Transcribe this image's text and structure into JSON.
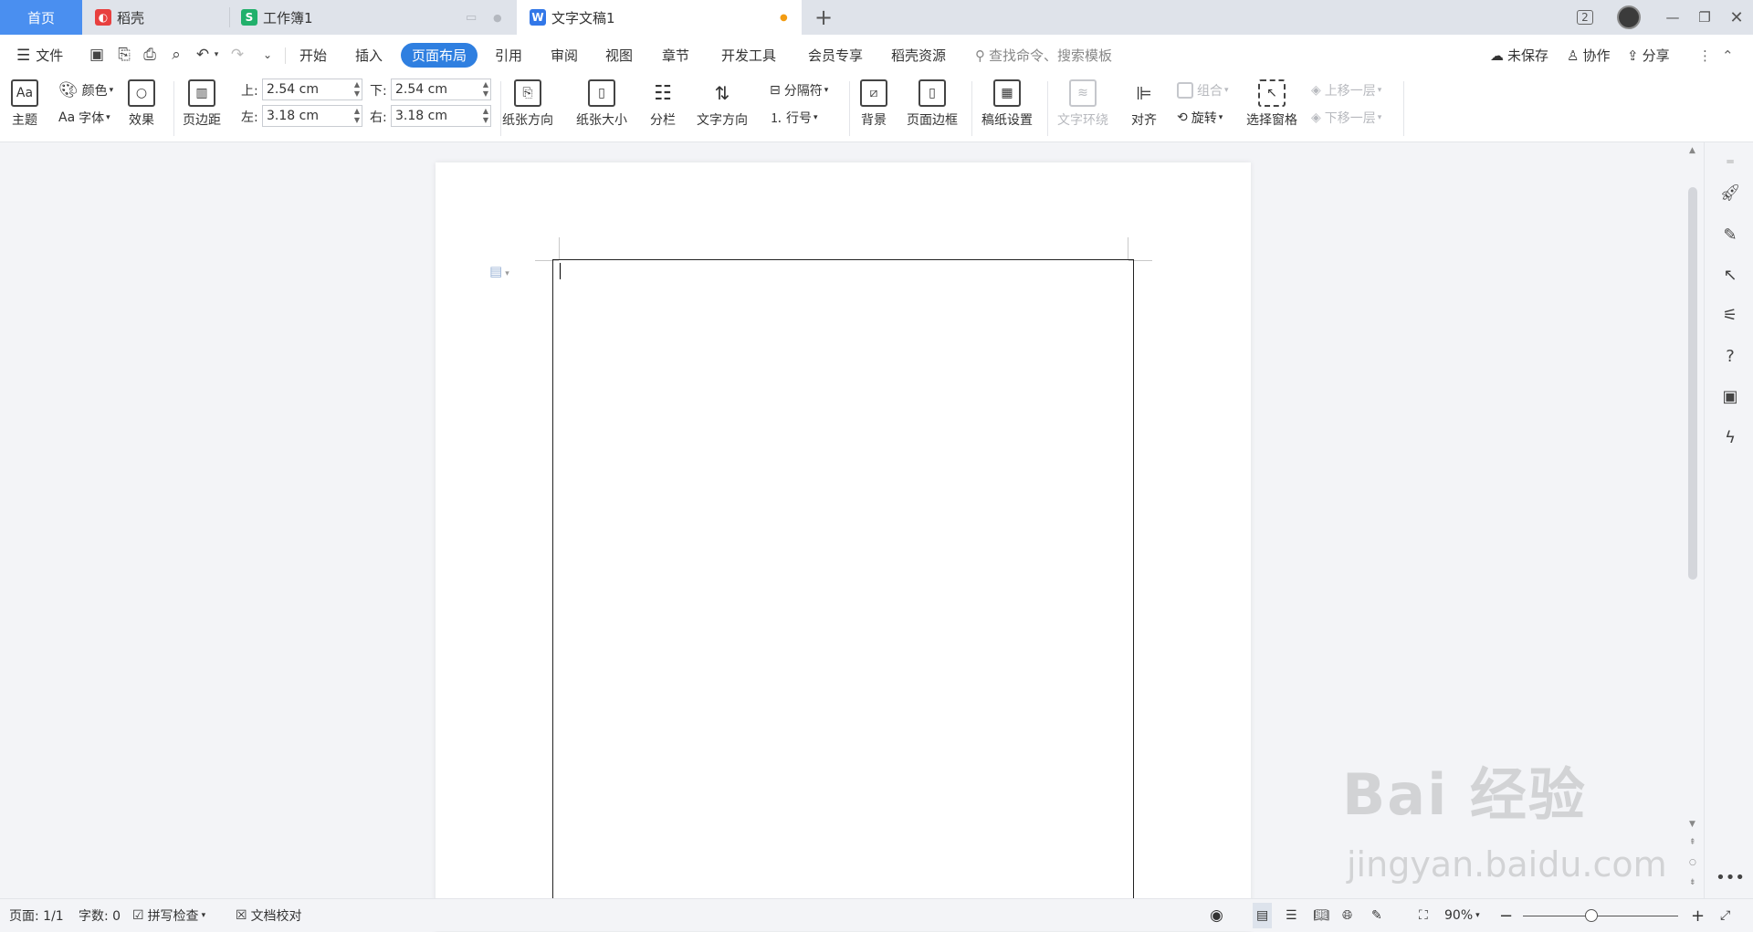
{
  "tabs": [
    {
      "label": "首页",
      "active": true
    },
    {
      "label": "稻壳",
      "icon": "daoke-icon"
    },
    {
      "label": "工作簿1",
      "icon": "spreadsheet-icon",
      "icon_letter": "S"
    },
    {
      "label": "文字文稿1",
      "icon": "writer-icon",
      "icon_letter": "W",
      "current": true
    }
  ],
  "window": {
    "badge": "2"
  },
  "menu": {
    "file": "文件",
    "items": [
      "开始",
      "插入",
      "页面布局",
      "引用",
      "审阅",
      "视图",
      "章节",
      "开发工具",
      "会员专享",
      "稻壳资源"
    ],
    "active": "页面布局",
    "search_placeholder": "查找命令、搜索模板",
    "unsaved": "未保存",
    "collab": "协作",
    "share": "分享"
  },
  "ribbon": {
    "theme": "主题",
    "color": "颜色",
    "font": "字体",
    "font_prefix": "Aa",
    "effect": "效果",
    "margins": "页边距",
    "top_label": "上:",
    "top_value": "2.54 cm",
    "bottom_label": "下:",
    "bottom_value": "2.54 cm",
    "left_label": "左:",
    "left_value": "3.18 cm",
    "right_label": "右:",
    "right_value": "3.18 cm",
    "orientation": "纸张方向",
    "size": "纸张大小",
    "columns": "分栏",
    "text_direction": "文字方向",
    "breaks": "分隔符",
    "line_numbers": "行号",
    "background": "背景",
    "page_border": "页面边框",
    "manuscript": "稿纸设置",
    "wrap": "文字环绕",
    "align": "对齐",
    "rotate": "旋转",
    "group": "组合",
    "selection_pane": "选择窗格",
    "bring_forward": "上移一层",
    "send_backward": "下移一层"
  },
  "status": {
    "page": "页面: 1/1",
    "words": "字数: 0",
    "spell": "拼写检查",
    "proof": "文档校对",
    "zoom": "90%"
  },
  "watermark": {
    "main": "Bai 经验",
    "sub": "jingyan.baidu.com"
  },
  "colors": {
    "accent": "#2f7fe0",
    "tab_home": "#4a8ff0",
    "daoke": "#e8403f",
    "sheet": "#21b06b",
    "writer": "#3277e8"
  }
}
